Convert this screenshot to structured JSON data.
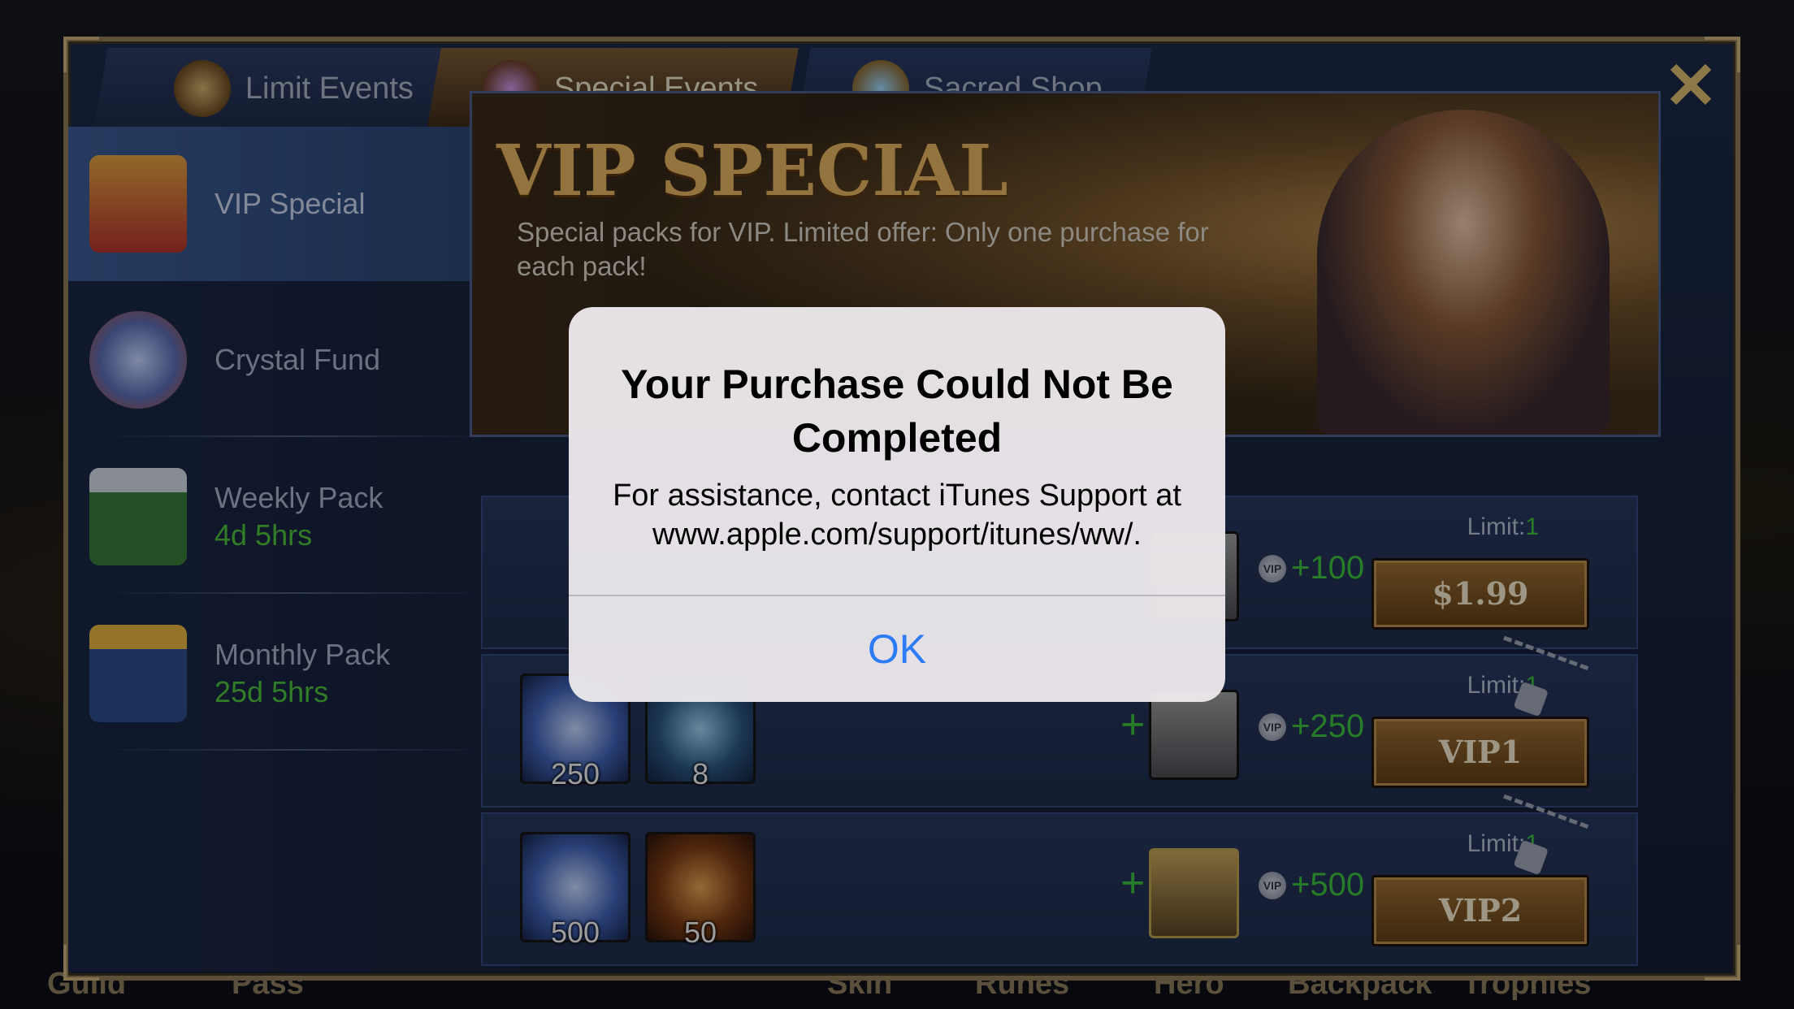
{
  "background": {
    "bottom_nav": [
      "Guild",
      "Pass",
      "Skin",
      "Runes",
      "Hero",
      "Backpack",
      "Trophies"
    ]
  },
  "tabs": [
    {
      "label": "Limit Events",
      "icon": "limit-events-icon"
    },
    {
      "label": "Special Events",
      "icon": "special-events-icon",
      "active": true
    },
    {
      "label": "Sacred Shop",
      "icon": "sacred-shop-icon"
    }
  ],
  "sidebar": {
    "items": [
      {
        "label": "VIP Special",
        "sub": "",
        "icon": "treasure-chest-icon"
      },
      {
        "label": "Crystal Fund",
        "sub": "",
        "icon": "crystal-icon"
      },
      {
        "label": "Weekly Pack",
        "sub": "4d 5hrs",
        "icon": "gift-icon"
      },
      {
        "label": "Monthly Pack",
        "sub": "25d 5hrs",
        "icon": "gift-icon"
      }
    ]
  },
  "banner": {
    "title": "VIP SPECIAL",
    "subtitle": "Special packs for VIP. Limited offer: Only one purchase for each pack!"
  },
  "packs": [
    {
      "items": [],
      "plus": "",
      "vip_gain": "+100",
      "limit_label": "Limit:",
      "limit_value": "1",
      "button": "$1.99",
      "locked": false
    },
    {
      "items": [
        {
          "count": "250"
        },
        {
          "count": "8"
        }
      ],
      "plus": "+",
      "vip_gain": "+250",
      "limit_label": "Limit:",
      "limit_value": "1",
      "button": "VIP1",
      "locked": true
    },
    {
      "items": [
        {
          "count": "500"
        },
        {
          "count": "50"
        }
      ],
      "plus": "+",
      "vip_gain": "+500",
      "limit_label": "Limit:",
      "limit_value": "1",
      "button": "VIP2",
      "locked": true
    }
  ],
  "vip_badge_text": "VIP",
  "alert": {
    "title": "Your Purchase Could Not Be Completed",
    "message": "For assistance, contact iTunes Support at www.apple.com/support/itunes/ww/.",
    "ok_label": "OK"
  },
  "colors": {
    "accent_green": "#3cbf3c",
    "ios_blue": "#2b7cf6",
    "gold": "#e3b360"
  }
}
